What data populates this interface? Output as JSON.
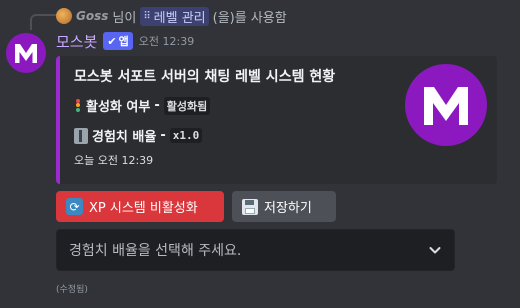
{
  "reply": {
    "username": "Goss",
    "prefix": "님이",
    "command": "레벨 관리",
    "suffix": "(을)를 사용함",
    "avatar_icon": "user-avatar-icon"
  },
  "message": {
    "username": "모스봇",
    "username_color": "#c9a8ff",
    "app_badge": "앱",
    "timestamp": "오전 12:39",
    "avatar_letter": "M",
    "avatar_color": "#8c19c0"
  },
  "embed": {
    "accent_color": "#9b2ad1",
    "title": "모스봇 서포트 서버의 채팅 레벨 시스템 현황",
    "fields": [
      {
        "icon": "traffic-light-icon",
        "name": "활성화 여부",
        "separator": "-",
        "value": "활성화됨"
      },
      {
        "icon": "pushpin-icon",
        "name": "경험치 배율",
        "separator": "-",
        "value": "x1.0"
      }
    ],
    "footer": "오늘 오전 12:39",
    "thumbnail_letter": "M",
    "thumbnail_color": "#8c19c0"
  },
  "buttons": {
    "toggle_xp": {
      "label": "XP 시스템 비활성화",
      "icon": "refresh-icon",
      "color": "#da373c"
    },
    "save": {
      "label": "저장하기",
      "icon": "floppy-disk-icon",
      "color": "#4e5058"
    }
  },
  "select": {
    "placeholder": "경험치 배율을 선택해 주세요.",
    "icon": "chevron-down-icon"
  },
  "edited_label": "(수정됨)"
}
